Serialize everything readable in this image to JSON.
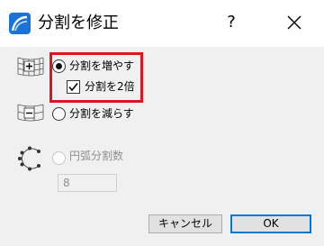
{
  "dialog": {
    "title": "分割を修正",
    "help": "?",
    "options": {
      "increase_label": "分割を増やす",
      "double_label": "分割を2倍",
      "decrease_label": "分割を減らす",
      "arc_label": "円弧分割数"
    },
    "arc_segments_value": "8",
    "buttons": {
      "cancel": "キャンセル",
      "ok": "OK"
    }
  },
  "state": {
    "selected_option": "increase",
    "double_checked": true,
    "arc_disabled": true
  },
  "colors": {
    "highlight": "#e0141e",
    "ok_border": "#0078d7",
    "content_bg": "#f0f0f0",
    "app_icon": "#1a73d9"
  },
  "icons": [
    "app-icon",
    "help-icon",
    "close-icon",
    "increase-grid-icon",
    "decrease-grid-icon",
    "arc-icon",
    "checkmark-icon"
  ]
}
